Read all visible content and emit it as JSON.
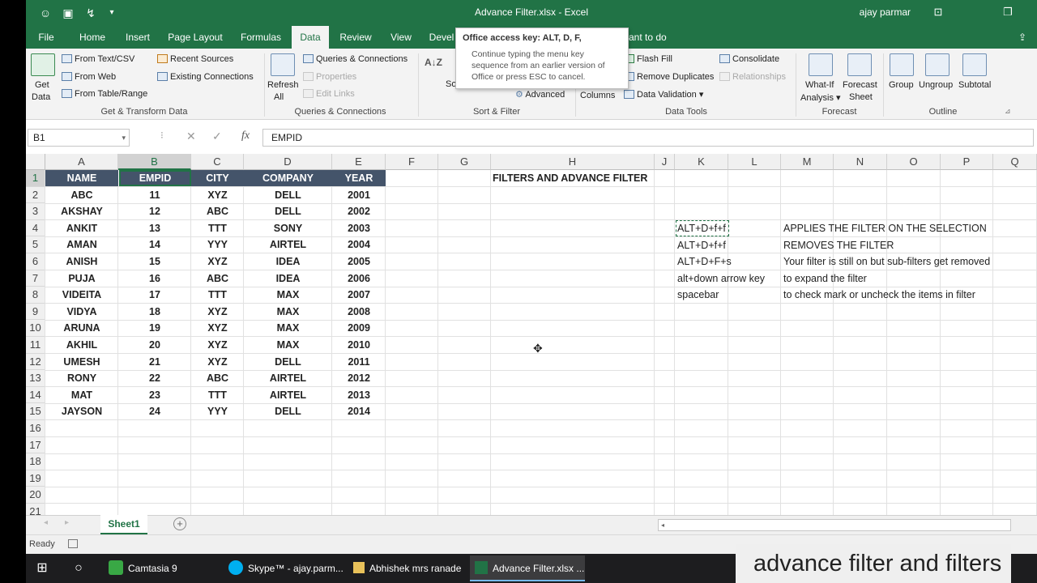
{
  "window": {
    "title": "Advance Filter.xlsx  -  Excel",
    "user": "ajay parmar"
  },
  "tabs": [
    "File",
    "Home",
    "Insert",
    "Page Layout",
    "Formulas",
    "Data",
    "Review",
    "View",
    "Devel",
    "ant to do"
  ],
  "ribbon": {
    "get_data": "Get",
    "get_data2": "Data",
    "from_text": "From Text/CSV",
    "from_web": "From Web",
    "from_table": "From Table/Range",
    "recent_sources": "Recent Sources",
    "existing_connections": "Existing Connections",
    "group_get": "Get & Transform Data",
    "refresh": "Refresh",
    "refresh2": "All",
    "queries_connections": "Queries & Connections",
    "properties": "Properties",
    "edit_links": "Edit Links",
    "group_queries": "Queries & Connections",
    "sort_az": "A↓Z",
    "sort_label": "So",
    "advanced": "Advanced",
    "group_sort": "Sort & Filter",
    "flash_fill": "Flash Fill",
    "remove_duplicates": "Remove Duplicates",
    "data_validation": "Data Validation",
    "columns": "Columns",
    "consolidate": "Consolidate",
    "relationships": "Relationships",
    "group_tools": "Data Tools",
    "what_if": "What-If",
    "what_if2": "Analysis",
    "forecast_sheet": "Forecast",
    "forecast_sheet2": "Sheet",
    "group_forecast": "Forecast",
    "group_btn": "Group",
    "ungroup_btn": "Ungroup",
    "subtotal_btn": "Subtotal",
    "group_outline": "Outline"
  },
  "tooltip": {
    "title": "Office access key: ALT, D, F,",
    "body": "Continue typing the menu key sequence from an earlier version of Office or press ESC to cancel."
  },
  "formula_bar": {
    "name_box": "B1",
    "fx": "fx",
    "value": "EMPID"
  },
  "columns": [
    "A",
    "B",
    "C",
    "D",
    "E",
    "F",
    "G",
    "H",
    "J",
    "K",
    "L",
    "M",
    "N",
    "O",
    "P",
    "Q"
  ],
  "rows": [
    "1",
    "2",
    "3",
    "4",
    "5",
    "6",
    "7",
    "8",
    "9",
    "10",
    "11",
    "12",
    "13",
    "14",
    "15",
    "16",
    "17",
    "18",
    "19",
    "20",
    "21"
  ],
  "table": {
    "headers": [
      "NAME",
      "EMPID",
      "CITY",
      "COMPANY",
      "YEAR"
    ],
    "rows": [
      [
        "ABC",
        "11",
        "XYZ",
        "DELL",
        "2001"
      ],
      [
        "AKSHAY",
        "12",
        "ABC",
        "DELL",
        "2002"
      ],
      [
        "ANKIT",
        "13",
        "TTT",
        "SONY",
        "2003"
      ],
      [
        "AMAN",
        "14",
        "YYY",
        "AIRTEL",
        "2004"
      ],
      [
        "ANISH",
        "15",
        "XYZ",
        "IDEA",
        "2005"
      ],
      [
        "PUJA",
        "16",
        "ABC",
        "IDEA",
        "2006"
      ],
      [
        "VIDEITA",
        "17",
        "TTT",
        "MAX",
        "2007"
      ],
      [
        "VIDYA",
        "18",
        "XYZ",
        "MAX",
        "2008"
      ],
      [
        "ARUNA",
        "19",
        "XYZ",
        "MAX",
        "2009"
      ],
      [
        "AKHIL",
        "20",
        "XYZ",
        "MAX",
        "2010"
      ],
      [
        "UMESH",
        "21",
        "XYZ",
        "DELL",
        "2011"
      ],
      [
        "RONY",
        "22",
        "ABC",
        "AIRTEL",
        "2012"
      ],
      [
        "MAT",
        "23",
        "TTT",
        "AIRTEL",
        "2013"
      ],
      [
        "JAYSON",
        "24",
        "YYY",
        "DELL",
        "2014"
      ]
    ]
  },
  "sheet_title": "FILTERS AND ADVANCE FILTER",
  "notes": [
    {
      "key": "ALT+D+f+f",
      "desc": "APPLIES THE FILTER ON THE SELECTION"
    },
    {
      "key": "ALT+D+f+f",
      "desc": "REMOVES THE FILTER"
    },
    {
      "key": "ALT+D+F+s",
      "desc": "Your filter is still on but sub-filters get removed"
    },
    {
      "key": "alt+down arrow key",
      "desc": "to expand the filter"
    },
    {
      "key": "spacebar",
      "desc": "to check mark or uncheck the items in filter"
    }
  ],
  "sheet_tab": "Sheet1",
  "status": "Ready",
  "taskbar": {
    "items": [
      "Camtasia 9",
      "Skype™ - ajay.parm...",
      "Abhishek mrs ranade",
      "Advance Filter.xlsx ..."
    ]
  },
  "caption": "advance filter and filters",
  "colors": {
    "accent": "#217346",
    "header_fill": "#44546a"
  }
}
